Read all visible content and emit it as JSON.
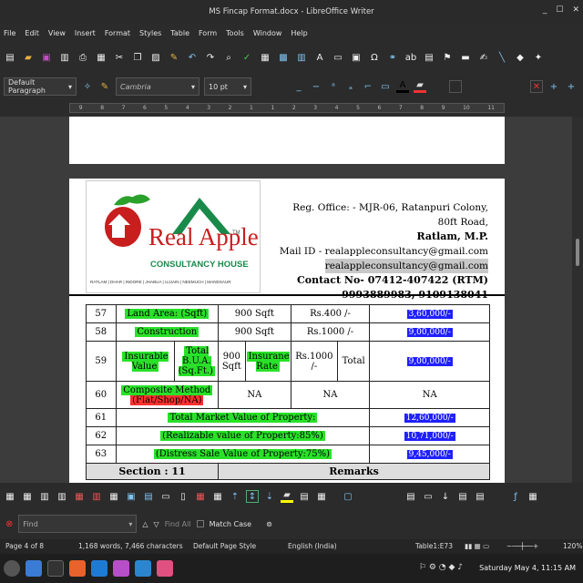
{
  "window": {
    "title": "MS Fincap Format.docx - LibreOffice Writer"
  },
  "menu": [
    "File",
    "Edit",
    "View",
    "Insert",
    "Format",
    "Styles",
    "Table",
    "Form",
    "Tools",
    "Window",
    "Help"
  ],
  "formatting": {
    "paragraph_style": "Default Paragraph",
    "font_name": "Cambria",
    "font_size": "10 pt"
  },
  "ruler_marks": [
    "9",
    "8",
    "7",
    "6",
    "5",
    "4",
    "3",
    "2",
    "1",
    "1",
    "2",
    "3",
    "4",
    "5",
    "6",
    "7",
    "8",
    "9",
    "10",
    "11"
  ],
  "letterhead": {
    "logo_text": "Real Apple",
    "logo_tm": "TM",
    "logo_sub": "CONSULTANCY HOUSE",
    "logo_cities": "RATLAM | DHAR | INDORE | JHABUA | UJJAIN | NEEMUCH | MANDSAUR",
    "office_line1": "Reg. Office: - MJR-06, Ratanpuri Colony, 80ft Road,",
    "office_line2": "Ratlam, M.P.",
    "mail_label": "Mail ID - realappleconsultancy@gmail.com",
    "mail_line2": "realappleconsultancy@gmail.com",
    "contact": "Contact No- 07412-407422 (RTM)",
    "phones": "9993889983, 9109138041"
  },
  "table": {
    "r57": {
      "no": "57",
      "label": "Land Area: (Sqft)",
      "qty": "900 Sqft",
      "rate": "Rs.400 /-",
      "value": "3,60,000/-"
    },
    "r58": {
      "no": "58",
      "label": "Construction",
      "qty": "900 Sqft",
      "rate": "Rs.1000 /-",
      "value": "9,00,000/-"
    },
    "r59": {
      "no": "59",
      "label": "Insurable Value",
      "bua": "Total B.U.A. (Sq.Ft.)",
      "qty": "900 Sqft",
      "rate_label": "Insurane Rate",
      "rate": "Rs.1000 /-",
      "total": "Total",
      "value": "9,00,000/-"
    },
    "r60": {
      "no": "60",
      "label1": "Composite Method",
      "label2": "(Flat/Shop/NA)",
      "c1": "NA",
      "c2": "NA",
      "c3": "NA"
    },
    "r61": {
      "no": "61",
      "label": "Total Market Value of Property:",
      "value": "12,60,000/-"
    },
    "r62": {
      "no": "62",
      "label": "(Realizable value of Property:85%)",
      "value": "10,71,000/-"
    },
    "r63": {
      "no": "63",
      "label": "(Distress Sale Value of Property:75%)",
      "value": "9,45,000/-"
    },
    "section_no": "Section : 11",
    "section_label": "Remarks"
  },
  "findbar": {
    "placeholder": "Find",
    "find_all": "Find All",
    "match_case": "Match Case"
  },
  "status": {
    "page": "Page 4 of 8",
    "words": "1,168 words, 7,466 characters",
    "page_style": "Default Page Style",
    "language": "English (India)",
    "cell": "Table1:E73",
    "zoom": "120%"
  },
  "taskbar": {
    "clock": "Saturday May 4, 11:15 AM"
  }
}
